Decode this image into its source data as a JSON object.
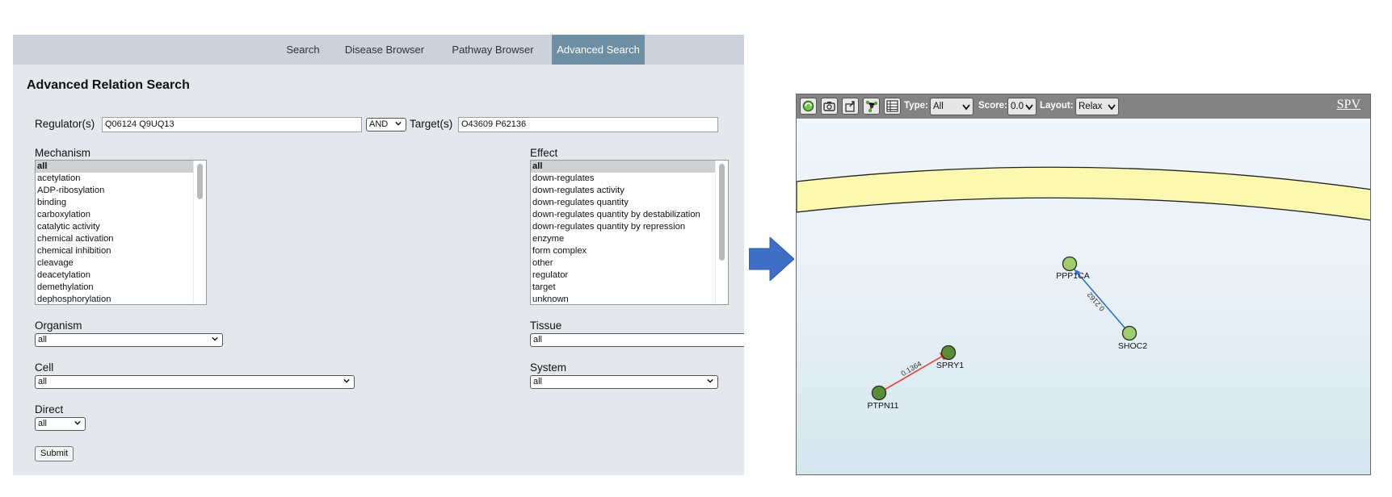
{
  "nav": {
    "tabs": [
      {
        "label": "Search"
      },
      {
        "label": "Disease Browser"
      },
      {
        "label": "Pathway Browser"
      },
      {
        "label": "Advanced Search",
        "active": true
      }
    ]
  },
  "form": {
    "title": "Advanced Relation Search",
    "regulator_label": "Regulator(s)",
    "regulator_value": "Q06124 Q9UQ13",
    "operator_value": "AND",
    "target_label": "Target(s)",
    "target_value": "O43609 P62136",
    "mechanism": {
      "label": "Mechanism",
      "items": [
        "all",
        "acetylation",
        "ADP-ribosylation",
        "binding",
        "carboxylation",
        "catalytic activity",
        "chemical activation",
        "chemical inhibition",
        "cleavage",
        "deacetylation",
        "demethylation",
        "dephosphorylation"
      ],
      "selected": "all"
    },
    "effect": {
      "label": "Effect",
      "items": [
        "all",
        "down-regulates",
        "down-regulates activity",
        "down-regulates quantity",
        "down-regulates quantity by destabilization",
        "down-regulates quantity by repression",
        "enzyme",
        "form complex",
        "other",
        "regulator",
        "target",
        "unknown"
      ],
      "selected": "all"
    },
    "organism": {
      "label": "Organism",
      "value": "all"
    },
    "tissue": {
      "label": "Tissue",
      "value": "all"
    },
    "cell": {
      "label": "Cell",
      "value": "all"
    },
    "system": {
      "label": "System",
      "value": "all"
    },
    "direct": {
      "label": "Direct",
      "value": "all"
    },
    "submit_label": "Submit"
  },
  "spv": {
    "toolbar": {
      "icons": [
        "refresh-icon",
        "camera-icon",
        "export-icon",
        "network-icon",
        "table-icon"
      ],
      "type_label": "Type:",
      "type_value": "All",
      "score_label": "Score:",
      "score_value": "0.0",
      "layout_label": "Layout:",
      "layout_value": "Relax",
      "link_label": "SPV"
    },
    "colors": {
      "membrane": "#fbf8b0",
      "node_light": "#9fcd6e",
      "node_dark": "#5b8c38",
      "edge_activation": "#2f6fcb",
      "edge_inhibition": "#e0453a"
    },
    "nodes": [
      {
        "id": "PPP1CA",
        "label": "PPP1CA",
        "shade": "light"
      },
      {
        "id": "SHOC2",
        "label": "SHOC2",
        "shade": "light"
      },
      {
        "id": "SPRY1",
        "label": "SPRY1",
        "shade": "dark"
      },
      {
        "id": "PTPN11",
        "label": "PTPN11",
        "shade": "dark"
      }
    ],
    "edges": [
      {
        "source": "SHOC2",
        "target": "PPP1CA",
        "score": "0.2162",
        "kind": "activation"
      },
      {
        "source": "PTPN11",
        "target": "SPRY1",
        "score": "0.1364",
        "kind": "inhibition"
      }
    ]
  }
}
